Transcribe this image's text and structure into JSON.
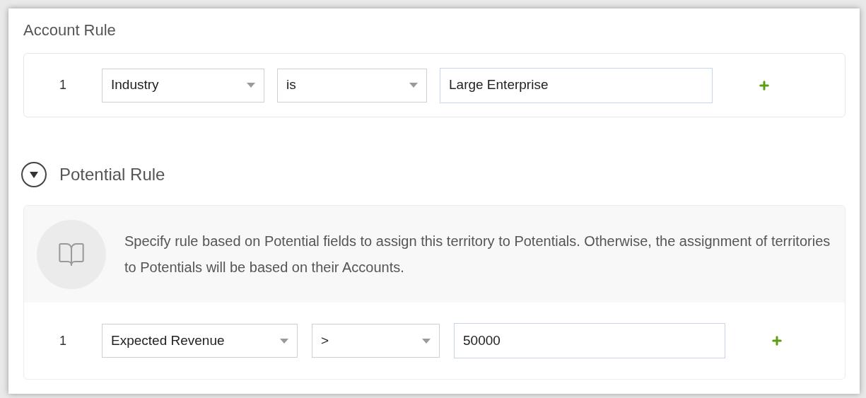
{
  "account_rule": {
    "title": "Account Rule",
    "conditions": [
      {
        "number": "1",
        "field": "Industry",
        "operator": "is",
        "value": "Large Enterprise"
      }
    ]
  },
  "potential_rule": {
    "title": "Potential Rule",
    "expanded": true,
    "info": "Specify rule based on Potential fields to assign this territory to Potentials. Otherwise, the assignment of territories to Potentials will be based on their  Accounts.",
    "conditions": [
      {
        "number": "1",
        "field": "Expected Revenue",
        "operator": ">",
        "value": "50000"
      }
    ]
  }
}
